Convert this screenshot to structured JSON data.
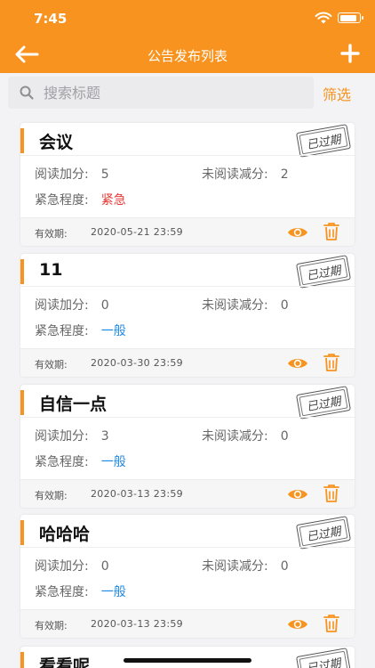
{
  "status": {
    "time": "7:45"
  },
  "header": {
    "title": "公告发布列表"
  },
  "search": {
    "placeholder": "搜索标题",
    "filter_label": "筛选"
  },
  "labels": {
    "read_add": "阅读加分:",
    "unread_minus": "未阅读减分:",
    "urgency": "紧急程度:",
    "valid_until": "有效期:",
    "expired_stamp": "已过期"
  },
  "colors": {
    "accent": "#f7931e",
    "urgent": "#e53935",
    "normal": "#1e88e5"
  },
  "notices": [
    {
      "title": "会议",
      "read_add": "5",
      "unread_minus": "2",
      "urgency": "紧急",
      "urgency_level": "urgent",
      "valid": "2020-05-21 23:59"
    },
    {
      "title": "11",
      "read_add": "0",
      "unread_minus": "0",
      "urgency": "一般",
      "urgency_level": "normal",
      "valid": "2020-03-30 23:59"
    },
    {
      "title": "自信一点",
      "read_add": "3",
      "unread_minus": "0",
      "urgency": "一般",
      "urgency_level": "normal",
      "valid": "2020-03-13 23:59"
    },
    {
      "title": "哈哈哈",
      "read_add": "0",
      "unread_minus": "0",
      "urgency": "一般",
      "urgency_level": "normal",
      "valid": "2020-03-13 23:59"
    },
    {
      "title": "看看呢"
    }
  ],
  "icons": {
    "back": "arrow-left-icon",
    "add": "plus-icon",
    "search": "search-icon",
    "view": "eye-icon",
    "delete": "trash-icon",
    "wifi": "wifi-icon",
    "battery": "battery-icon"
  }
}
